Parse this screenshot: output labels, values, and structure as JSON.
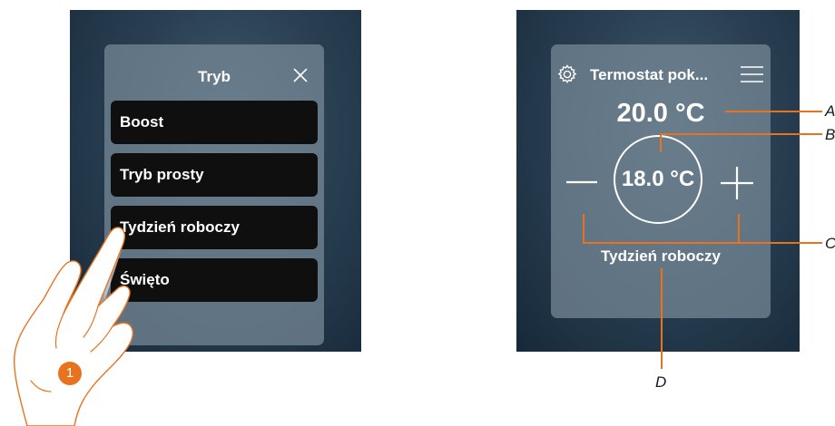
{
  "left_screen": {
    "title": "Tryb",
    "close_icon": "close-icon",
    "modes": [
      "Boost",
      "Tryb prosty",
      "Tydzień roboczy",
      "Święto"
    ]
  },
  "right_screen": {
    "title": "Termostat pok...",
    "settings_icon": "gear-icon",
    "menu_icon": "menu-icon",
    "current_temp": "20.0 °C",
    "setpoint": "18.0 °C",
    "decrease_icon": "minus-icon",
    "increase_icon": "plus-icon",
    "mode": "Tydzień roboczy"
  },
  "callouts": {
    "a": "A",
    "b": "B",
    "c": "C",
    "d": "D"
  },
  "step": "1",
  "colors": {
    "accent": "#e8731f",
    "screen_bg": "#2a4052",
    "panel": "#788a98",
    "button": "#0f0f10"
  }
}
